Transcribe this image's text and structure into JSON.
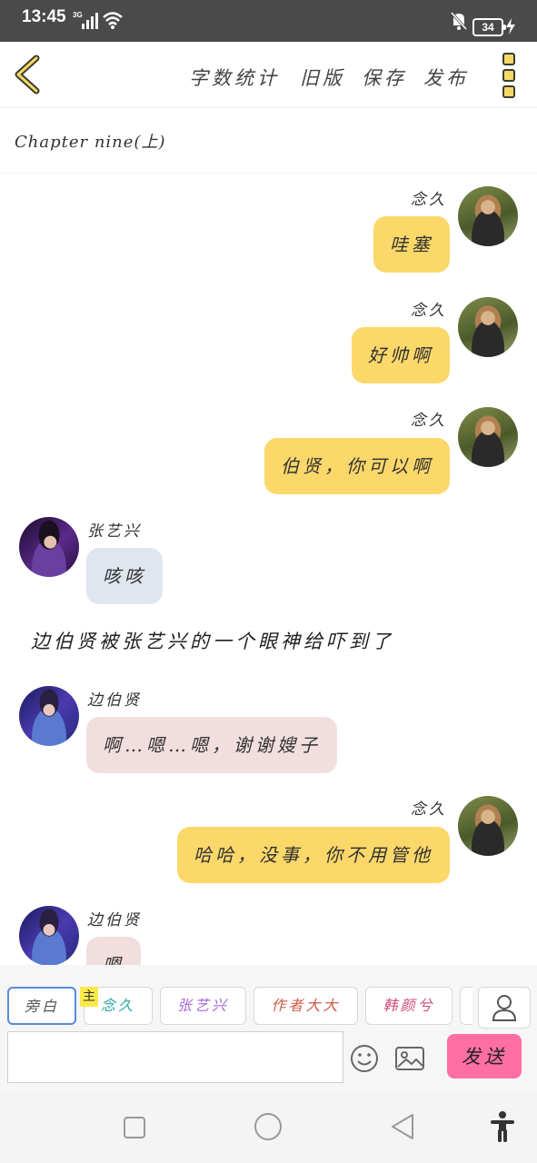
{
  "status_bar": {
    "time": "13:45",
    "network": "3G",
    "battery": "34"
  },
  "toolbar": {
    "actions": [
      "字数统计",
      "旧版",
      "保存",
      "发布"
    ]
  },
  "chapter": {
    "title": "Chapter nine(上)"
  },
  "messages": [
    {
      "side": "right",
      "name": "念久",
      "text": "哇塞",
      "avatar": "nianjiu-avatar"
    },
    {
      "side": "right",
      "name": "念久",
      "text": "好帅啊",
      "avatar": "nianjiu-avatar"
    },
    {
      "side": "right",
      "name": "念久",
      "text": "伯贤，你可以啊",
      "avatar": "nianjiu-avatar"
    },
    {
      "side": "left",
      "name": "张艺兴",
      "text": "咳咳",
      "avatar": "zhangyixing-avatar"
    },
    {
      "narration": "边伯贤被张艺兴的一个眼神给吓到了"
    },
    {
      "side": "left",
      "name": "边伯贤",
      "text": "啊…嗯…嗯，谢谢嫂子",
      "avatar": "bianboxian-avatar"
    },
    {
      "side": "right",
      "name": "念久",
      "text": "哈哈，没事，你不用管他",
      "avatar": "nianjiu-avatar"
    },
    {
      "side": "left",
      "name": "边伯贤",
      "text": "嗯",
      "avatar": "bianboxian-avatar"
    }
  ],
  "roles": {
    "items": [
      "旁白",
      "念久",
      "张艺兴",
      "作者大大",
      "韩颜兮"
    ],
    "main_tag": "主",
    "colors": [
      "#555555",
      "#2aa7a0",
      "#a76ad6",
      "#d05a4a",
      "#d04a7a"
    ]
  },
  "composer": {
    "input_value": "",
    "input_placeholder": "",
    "send_label": "发送"
  },
  "colors": {
    "accent": "#fcd86a",
    "send": "#ff6fa3",
    "left_bubble_1": "#e0e6ee",
    "left_bubble_2": "#f2dede"
  }
}
